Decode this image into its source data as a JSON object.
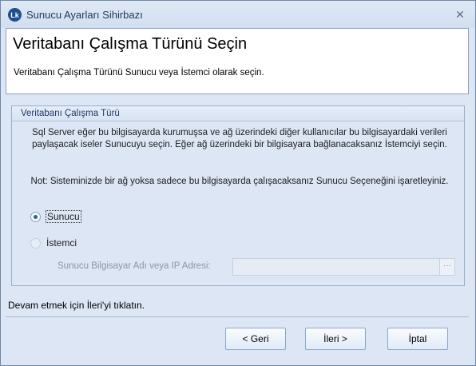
{
  "window": {
    "title": "Sunucu Ayarları Sihirbazı",
    "app_icon_text": "Lk",
    "close_glyph": "✕"
  },
  "header": {
    "title": "Veritabanı Çalışma Türünü Seçin",
    "subtitle": "Veritabanı Çalışma Türünü Sunucu veya İstemci olarak seçin."
  },
  "group": {
    "caption": "Veritabanı Çalışma Türü",
    "description_1": "Sql Server eğer bu bilgisayarda kurumuşsa ve ağ üzerindeki diğer kullanıcılar bu bilgisayardaki verileri paylaşacak iseler Sunucuyu seçin. Eğer ağ üzerindeki bir bilgisayara bağlanacaksanız İstemciyi seçin.",
    "description_2": "Not: Sisteminizde bir ağ yoksa sadece  bu bilgisayarda çalışacaksanız Sunucu Seçeneğini işaretleyiniz.",
    "options": [
      {
        "label": "Sunucu",
        "checked": true,
        "enabled": true
      },
      {
        "label": "İstemci",
        "checked": false,
        "enabled": false
      }
    ],
    "ip_label": "Sunucu Bilgisayar Adı veya IP Adresi:",
    "ip_value": "",
    "browse_label": "···"
  },
  "status_text": "Devam etmek için İleri'yi tıklatın.",
  "buttons": {
    "back": "< Geri",
    "next": "İleri >",
    "cancel": "İptal"
  },
  "colors": {
    "window_bg": "#dce6f4",
    "accent": "#1f4e8c",
    "border": "#8da2bf"
  }
}
